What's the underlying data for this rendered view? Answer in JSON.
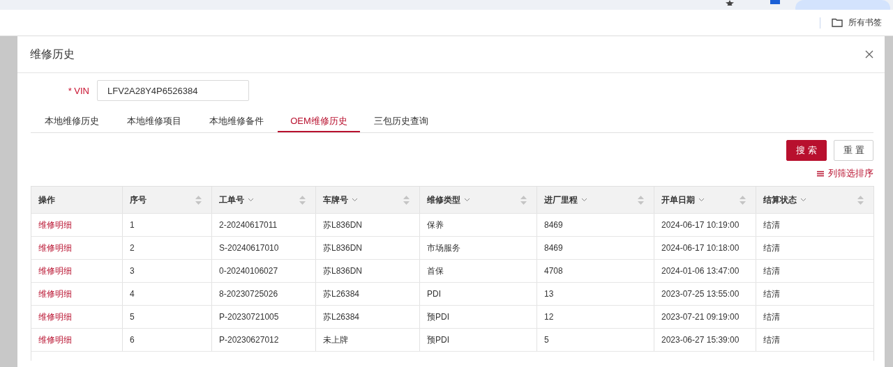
{
  "browser": {
    "bookmarks_label": "所有书签"
  },
  "dialog": {
    "title": "维修历史",
    "vin": {
      "label": "* VIN",
      "value": "LFV2A28Y4P6526384"
    },
    "tabs": [
      {
        "label": "本地维修历史",
        "selected": false
      },
      {
        "label": "本地维修项目",
        "selected": false
      },
      {
        "label": "本地维修备件",
        "selected": false
      },
      {
        "label": "OEM维修历史",
        "selected": true
      },
      {
        "label": "三包历史查询",
        "selected": false
      }
    ],
    "buttons": [
      {
        "label": "搜索",
        "kind": "primary"
      },
      {
        "label": "重置",
        "kind": "default"
      }
    ],
    "column_filter_link": "列筛选排序",
    "table": {
      "columns": [
        {
          "label": "操作",
          "sortable": false,
          "filterable": false
        },
        {
          "label": "序号",
          "sortable": true,
          "filterable": false
        },
        {
          "label": "工单号",
          "sortable": true,
          "filterable": true
        },
        {
          "label": "车牌号",
          "sortable": true,
          "filterable": true
        },
        {
          "label": "维修类型",
          "sortable": true,
          "filterable": true
        },
        {
          "label": "进厂里程",
          "sortable": true,
          "filterable": true
        },
        {
          "label": "开单日期",
          "sortable": true,
          "filterable": true
        },
        {
          "label": "结算状态",
          "sortable": true,
          "filterable": true
        }
      ],
      "rows": [
        [
          "维修明细",
          "1",
          "2-20240617011",
          "苏L836DN",
          "保养",
          "8469",
          "2024-06-17 10:19:00",
          "结清"
        ],
        [
          "维修明细",
          "2",
          "S-20240617010",
          "苏L836DN",
          "市场服务",
          "8469",
          "2024-06-17 10:18:00",
          "结清"
        ],
        [
          "维修明细",
          "3",
          "0-20240106027",
          "苏L836DN",
          "首保",
          "4708",
          "2024-01-06 13:47:00",
          "结清"
        ],
        [
          "维修明细",
          "4",
          "8-20230725026",
          "苏L26384",
          "PDI",
          "13",
          "2023-07-25 13:55:00",
          "结清"
        ],
        [
          "维修明细",
          "5",
          "P-20230721005",
          "苏L26384",
          "预PDI",
          "12",
          "2023-07-21 09:19:00",
          "结清"
        ],
        [
          "维修明细",
          "6",
          "P-20230627012",
          "未上牌",
          "预PDI",
          "5",
          "2023-06-27 15:39:00",
          "结清"
        ]
      ]
    }
  }
}
